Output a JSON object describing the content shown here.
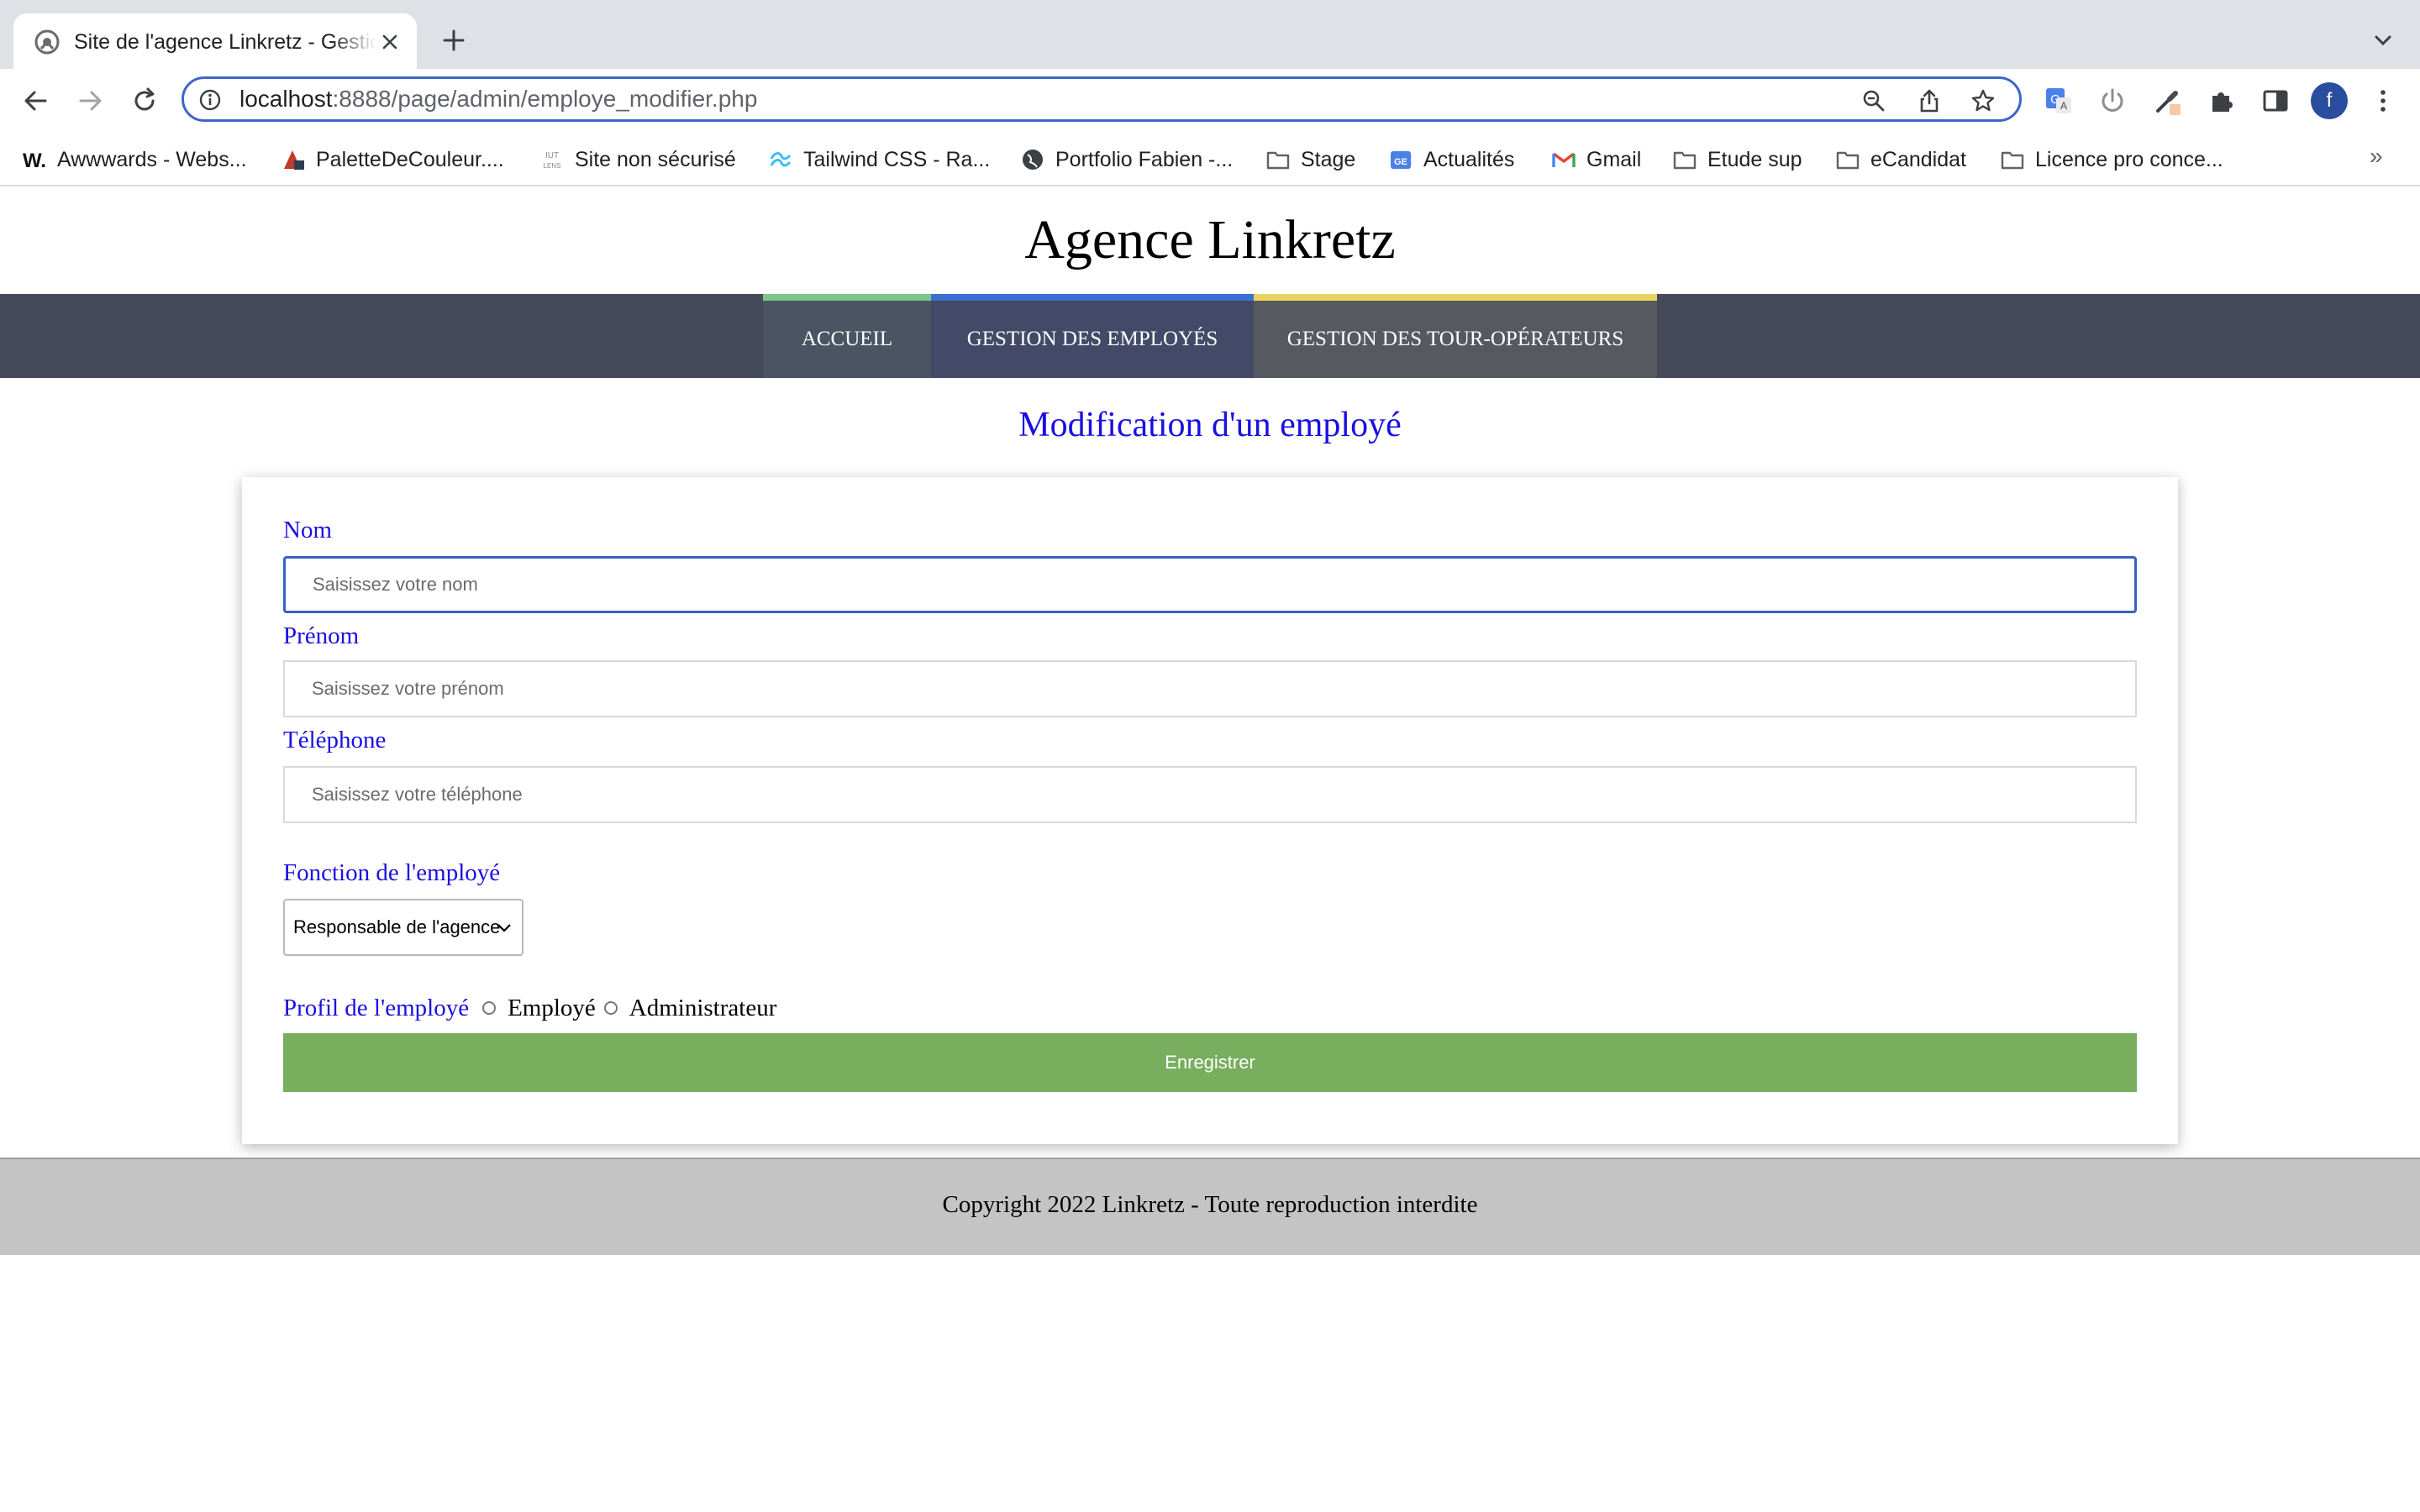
{
  "browser": {
    "tab": {
      "title": "Site de l'agence Linkretz - Gestion des employés"
    },
    "url": {
      "host": "localhost",
      "path": ":8888/page/admin/employe_modifier.php"
    },
    "profile_initial": "f",
    "bookmarks": [
      {
        "label": "Awwwards - Webs...",
        "icon": "awwwards-icon"
      },
      {
        "label": "PaletteDeCouleur....",
        "icon": "palette-icon"
      },
      {
        "label": "Site non sécurisé",
        "icon": "iut-icon"
      },
      {
        "label": "Tailwind CSS - Ra...",
        "icon": "tailwind-icon"
      },
      {
        "label": "Portfolio Fabien -...",
        "icon": "globe-icon"
      },
      {
        "label": "Stage",
        "icon": "folder-icon"
      },
      {
        "label": "Actualités",
        "icon": "news-icon"
      },
      {
        "label": "Gmail",
        "icon": "gmail-icon"
      },
      {
        "label": "Etude sup",
        "icon": "folder-icon"
      },
      {
        "label": "eCandidat",
        "icon": "folder-icon"
      },
      {
        "label": "Licence pro conce...",
        "icon": "folder-icon"
      }
    ],
    "bookmarks_more": "»"
  },
  "site": {
    "title": "Agence Linkretz",
    "nav": [
      {
        "label": "ACCUEIL",
        "accent": "#7cc489",
        "bg": "#4b5463"
      },
      {
        "label": "GESTION DES EMPLOYÉS",
        "accent": "#3c6fd0",
        "bg": "#434a67"
      },
      {
        "label": "GESTION DES TOUR-OPÉRATEURS",
        "accent": "#e9d25f",
        "bg": "#575960"
      }
    ]
  },
  "form": {
    "heading": "Modification d'un employé",
    "nom": {
      "label": "Nom",
      "placeholder": "Saisissez votre nom"
    },
    "prenom": {
      "label": "Prénom",
      "placeholder": "Saisissez votre prénom"
    },
    "telephone": {
      "label": "Téléphone",
      "placeholder": "Saisissez votre téléphone"
    },
    "fonction": {
      "label": "Fonction de l'employé",
      "selected": "Responsable de l'agence"
    },
    "profil": {
      "label": "Profil de l'employé",
      "options": [
        "Employé",
        "Administrateur"
      ]
    },
    "submit_label": "Enregistrer"
  },
  "footer": {
    "text": "Copyright 2022 Linkretz - Toute reproduction interdite"
  },
  "colors": {
    "label": "#1a10e0",
    "navbar": "#444a5a",
    "button": "#78ae5d",
    "footer": "#c4c4c4"
  }
}
